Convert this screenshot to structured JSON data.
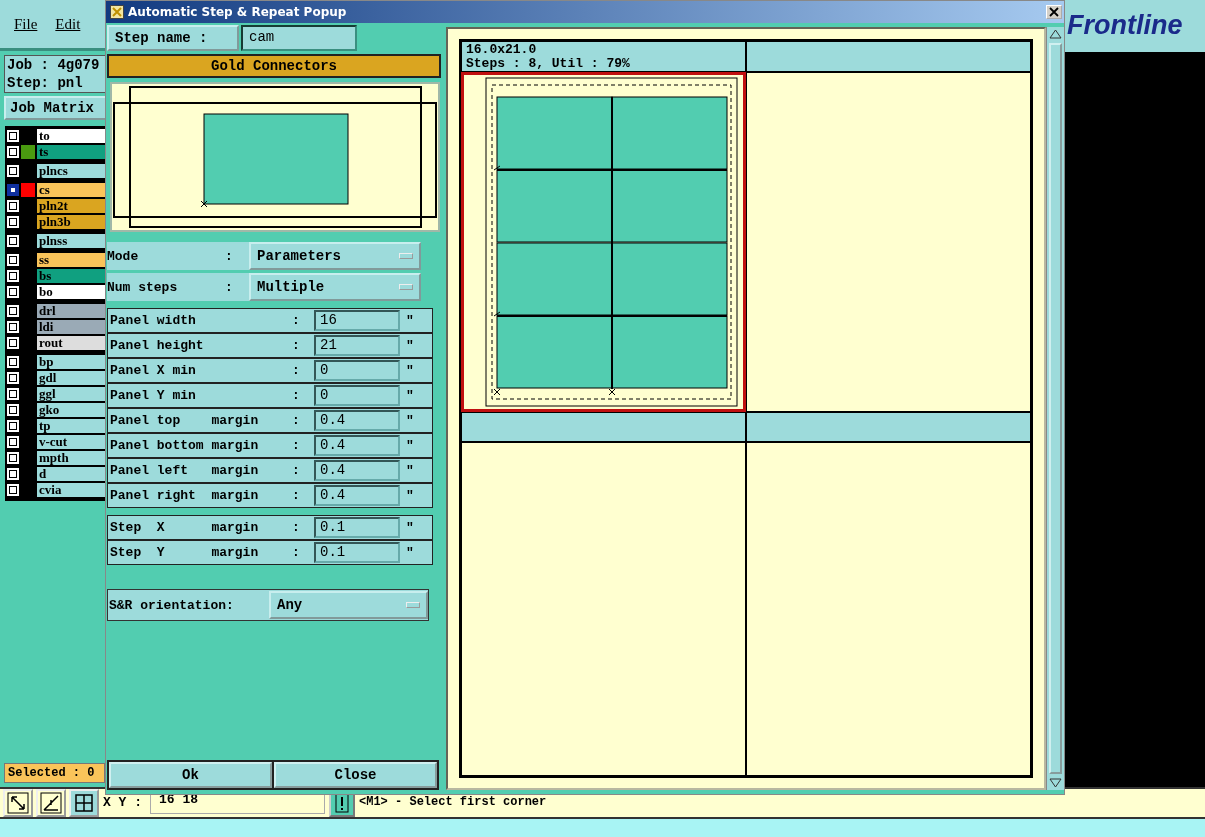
{
  "app": {
    "menu": [
      "File",
      "Edit"
    ],
    "job": "Job : 4g079",
    "step": "Step: pnl",
    "job_matrix": "Job Matrix",
    "layer_groups": [
      [
        {
          "name": "to",
          "kind": "silk",
          "selected": false
        },
        {
          "name": "ts",
          "kind": "mask",
          "color": "#4a9a10",
          "selected": false
        }
      ],
      [
        {
          "name": "plncs",
          "kind": "document",
          "selected": false
        }
      ],
      [
        {
          "name": "cs",
          "kind": "signal",
          "color": "#ff0000",
          "selected": true
        },
        {
          "name": "pln2t",
          "kind": "plane",
          "selected": false
        },
        {
          "name": "pln3b",
          "kind": "plane",
          "selected": false
        }
      ],
      [
        {
          "name": "plnss",
          "kind": "document",
          "selected": false
        }
      ],
      [
        {
          "name": "ss",
          "kind": "signal",
          "selected": false
        },
        {
          "name": "bs",
          "kind": "mask",
          "selected": false
        },
        {
          "name": "bo",
          "kind": "silk",
          "selected": false
        }
      ],
      [
        {
          "name": "drl",
          "kind": "drill",
          "selected": false
        },
        {
          "name": "ldi",
          "kind": "drill",
          "selected": false
        },
        {
          "name": "rout",
          "kind": "rout",
          "selected": false
        }
      ],
      [
        {
          "name": "bp",
          "kind": "document",
          "selected": false
        },
        {
          "name": "gdl",
          "kind": "document",
          "selected": false
        },
        {
          "name": "ggl",
          "kind": "document",
          "selected": false
        },
        {
          "name": "gko",
          "kind": "document",
          "selected": false
        },
        {
          "name": "tp",
          "kind": "document",
          "selected": false
        },
        {
          "name": "v-cut",
          "kind": "document",
          "selected": false
        },
        {
          "name": "mpth",
          "kind": "document",
          "selected": false
        },
        {
          "name": "d",
          "kind": "document",
          "selected": false
        },
        {
          "name": "cvia",
          "kind": "document",
          "selected": false
        }
      ]
    ],
    "selected_count": "Selected : 0",
    "logo": "Frontline",
    "coords_label": "X Y :",
    "coords": "16 18",
    "message": "<M1> - Select first corner"
  },
  "popup": {
    "title": "Automatic Step & Repeat Popup",
    "step_name_label": "Step name :",
    "step_name": "cam",
    "step_title": "Gold Connectors",
    "options": [
      {
        "label": "Mode",
        "colon": ":",
        "value": "Parameters"
      },
      {
        "label": "Num steps",
        "colon": ":",
        "value": "Multiple"
      }
    ],
    "parameter_groups": [
      [
        {
          "label": "Panel width",
          "colon": ":",
          "value": "16",
          "unit": "\""
        },
        {
          "label": "Panel height",
          "colon": ":",
          "value": "21",
          "unit": "\""
        },
        {
          "label": "Panel X min",
          "colon": ":",
          "value": "0",
          "unit": "\""
        },
        {
          "label": "Panel Y min",
          "colon": ":",
          "value": "0",
          "unit": "\""
        },
        {
          "label": "Panel top    margin",
          "colon": ":",
          "value": "0.4",
          "unit": "\""
        },
        {
          "label": "Panel bottom margin",
          "colon": ":",
          "value": "0.4",
          "unit": "\""
        },
        {
          "label": "Panel left   margin",
          "colon": ":",
          "value": "0.4",
          "unit": "\""
        },
        {
          "label": "Panel right  margin",
          "colon": ":",
          "value": "0.4",
          "unit": "\""
        }
      ],
      [
        {
          "label": "Step  X      margin",
          "colon": ":",
          "value": "0.1",
          "unit": "\""
        },
        {
          "label": "Step  Y      margin",
          "colon": ":",
          "value": "0.1",
          "unit": "\""
        }
      ]
    ],
    "orientation": {
      "label": "S&R orientation:",
      "value": "Any"
    },
    "buttons": [
      "Ok",
      "Close"
    ],
    "cells": [
      {
        "kind": "layout",
        "selected": true,
        "header": [
          "16.0x21.0",
          "Steps : 8, Util : 79%"
        ]
      },
      {
        "kind": "empty",
        "selected": false
      },
      {
        "kind": "empty",
        "selected": false
      },
      {
        "kind": "empty",
        "selected": false
      }
    ]
  }
}
